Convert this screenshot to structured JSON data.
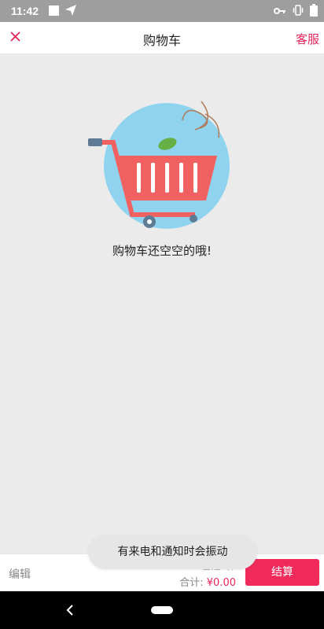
{
  "status": {
    "time": "11:42"
  },
  "header": {
    "title": "购物车",
    "service_label": "客服"
  },
  "empty_state": {
    "message": "购物车还空空的哦!"
  },
  "footer": {
    "edit_label": "编辑",
    "selected_text": "已选0件",
    "total_label": "合计:",
    "total_amount": "¥0.00",
    "checkout_label": "结算"
  },
  "toast": {
    "text": "有来电和通知时会振动"
  },
  "colors": {
    "accent": "#f02a5a",
    "cart_red": "#f26161",
    "circle_blue": "#8fd3ee"
  }
}
